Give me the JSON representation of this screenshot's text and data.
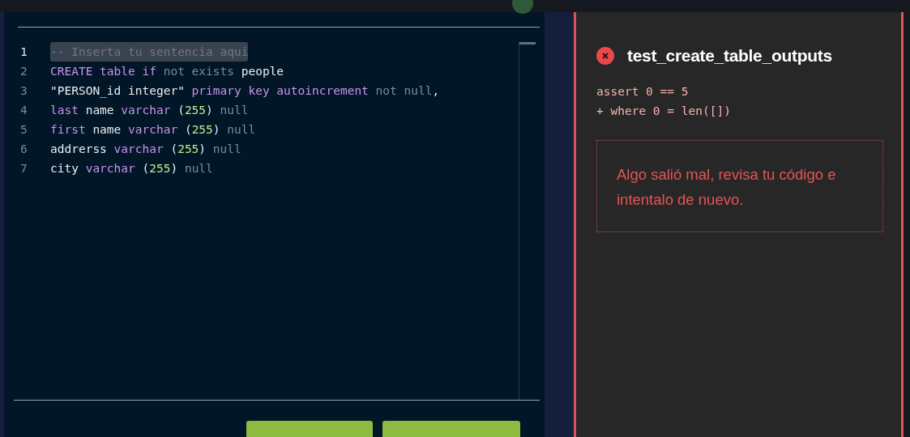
{
  "editor": {
    "lines": [
      {
        "number": "1",
        "selected": true,
        "tokens": [
          {
            "text": "-- Inserta tu sentencia aqui",
            "kind": "comment"
          }
        ]
      },
      {
        "number": "2",
        "selected": false,
        "tokens": [
          {
            "text": "CREATE table if",
            "kind": "keyword"
          },
          {
            "text": " not exists",
            "kind": "muted"
          },
          {
            "text": " people",
            "kind": "plain"
          }
        ]
      },
      {
        "number": "3",
        "selected": false,
        "tokens": [
          {
            "text": "\"PERSON_id integer\"",
            "kind": "plain"
          },
          {
            "text": " primary key autoincrement",
            "kind": "keyword"
          },
          {
            "text": " not null",
            "kind": "muted"
          },
          {
            "text": ",",
            "kind": "plain"
          }
        ]
      },
      {
        "number": "4",
        "selected": false,
        "tokens": [
          {
            "text": "last",
            "kind": "keyword"
          },
          {
            "text": " name",
            "kind": "plain"
          },
          {
            "text": " varchar",
            "kind": "keyword"
          },
          {
            "text": " (",
            "kind": "plain"
          },
          {
            "text": "255",
            "kind": "number"
          },
          {
            "text": ")",
            "kind": "plain"
          },
          {
            "text": " null",
            "kind": "muted"
          }
        ]
      },
      {
        "number": "5",
        "selected": false,
        "tokens": [
          {
            "text": "first",
            "kind": "keyword"
          },
          {
            "text": " name",
            "kind": "plain"
          },
          {
            "text": " varchar",
            "kind": "keyword"
          },
          {
            "text": " (",
            "kind": "plain"
          },
          {
            "text": "255",
            "kind": "number"
          },
          {
            "text": ")",
            "kind": "plain"
          },
          {
            "text": " null",
            "kind": "muted"
          }
        ]
      },
      {
        "number": "6",
        "selected": false,
        "tokens": [
          {
            "text": "addrerss",
            "kind": "plain"
          },
          {
            "text": " varchar",
            "kind": "keyword"
          },
          {
            "text": " (",
            "kind": "plain"
          },
          {
            "text": "255",
            "kind": "number"
          },
          {
            "text": ")",
            "kind": "plain"
          },
          {
            "text": " null",
            "kind": "muted"
          }
        ]
      },
      {
        "number": "7",
        "selected": false,
        "tokens": [
          {
            "text": "city",
            "kind": "plain"
          },
          {
            "text": " varchar",
            "kind": "keyword"
          },
          {
            "text": " (",
            "kind": "plain"
          },
          {
            "text": "255",
            "kind": "number"
          },
          {
            "text": ")",
            "kind": "plain"
          },
          {
            "text": " null",
            "kind": "muted"
          }
        ]
      }
    ]
  },
  "action_buttons": [
    {
      "kind": "button"
    },
    {
      "kind": "button"
    }
  ],
  "result": {
    "failed": true,
    "title": "test_create_table_outputs",
    "output": [
      "assert 0 == 5",
      "+ where 0 = len([])"
    ],
    "message": "Algo salió mal, revisa tu código e intentalo de nuevo."
  }
}
